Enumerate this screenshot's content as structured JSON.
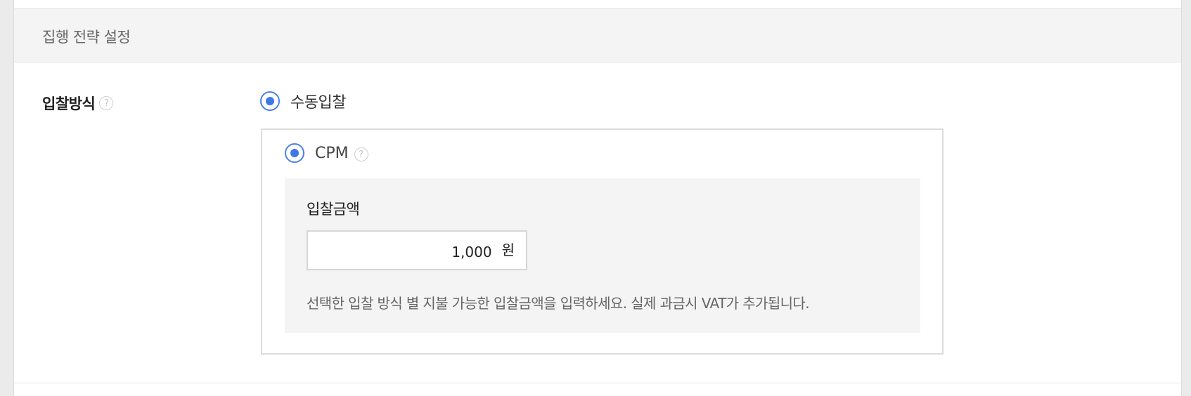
{
  "section": {
    "title": "집행 전략 설정"
  },
  "bid_method": {
    "label": "입찰방식",
    "help_icon": "?",
    "manual_option_label": "수동입찰",
    "cpm_option_label": "CPM",
    "cpm_help_icon": "?"
  },
  "bid_amount": {
    "label": "입찰금액",
    "value": "1,000",
    "unit": "원",
    "help_text": "선택한 입찰 방식 별 지불 가능한 입찰금액을 입력하세요. 실제 과금시 VAT가 추가됩니다."
  },
  "colors": {
    "radio_accent": "#3d78e6",
    "section_header_bg": "#f4f4f4",
    "amount_panel_bg": "#f4f4f4"
  }
}
